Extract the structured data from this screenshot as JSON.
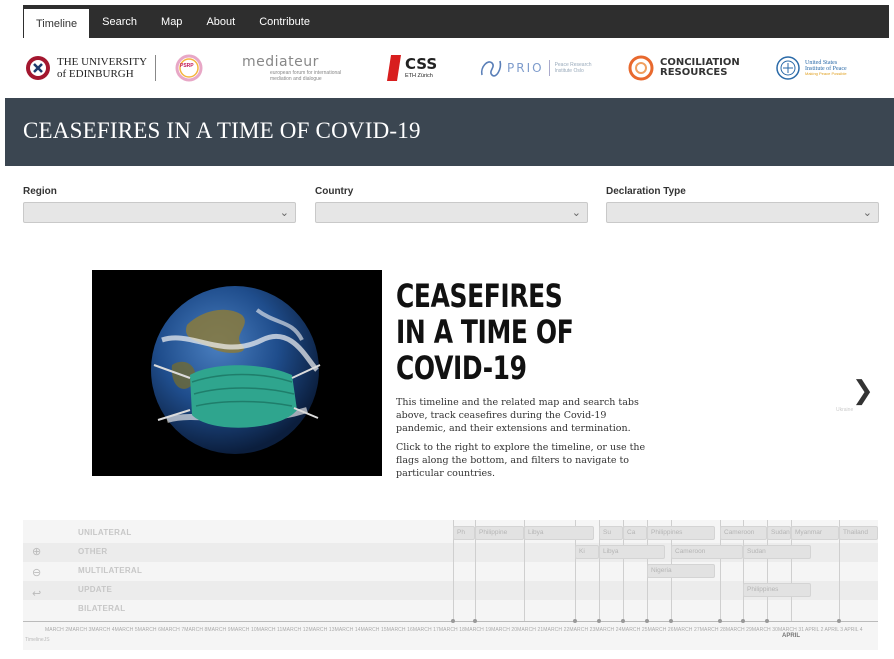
{
  "nav": {
    "tabs": [
      {
        "label": "Timeline",
        "active": true
      },
      {
        "label": "Search",
        "active": false
      },
      {
        "label": "Map",
        "active": false
      },
      {
        "label": "About",
        "active": false
      },
      {
        "label": "Contribute",
        "active": false
      }
    ]
  },
  "logos": {
    "edinburgh": {
      "line1": "THE UNIVERSITY",
      "line2": "of EDINBURGH"
    },
    "psrp": {
      "label": "PSRP"
    },
    "mediateur": {
      "name": "mediateur",
      "sub": "european forum for international mediation and dialogue"
    },
    "css": {
      "name": "CSS",
      "sub": "ETH Zürich"
    },
    "prio": {
      "name": "PRIO",
      "sub": "Peace Research Institute Oslo"
    },
    "conciliation": {
      "line1": "CONCILIATION",
      "line2": "RESOURCES"
    },
    "usip": {
      "line1": "United States",
      "line2": "Institute of Peace",
      "line3": "Making Peace Possible"
    }
  },
  "banner": {
    "title": "CEASEFIRES IN A TIME OF COVID-19"
  },
  "filters": {
    "region": {
      "label": "Region",
      "value": ""
    },
    "country": {
      "label": "Country",
      "value": ""
    },
    "declaration_type": {
      "label": "Declaration Type",
      "value": ""
    }
  },
  "slide": {
    "title": "CEASEFIRES IN A TIME OF COVID-19",
    "paragraph1": "This timeline and the related map and search tabs above, track ceasefires during the Covid-19 pandemic, and their extensions and termination.",
    "paragraph2": "Click to the right to explore the timeline, or use the flags along the bottom, and filters to navigate to particular countries.",
    "next_label": "Ukraine"
  },
  "timeline": {
    "rows": [
      "UNILATERAL",
      "OTHER",
      "MULTILATERAL",
      "UPDATE",
      "BILATERAL"
    ],
    "events": {
      "r0a": "Ph",
      "r0b": "Philippine",
      "r0c": "Libya",
      "r0d": "Su",
      "r0e": "Ca",
      "r0f": "Philippines",
      "r0g": "Cameroon",
      "r0h": "Sudan",
      "r0i": "Myanmar",
      "r0j": "Thailand",
      "r1a": "Ki",
      "r1b": "Libya",
      "r1c": "Cameroon",
      "r1d": "Sudan",
      "r2a": "Nigeria",
      "r3a": "Philippines"
    },
    "tick_labels": "MARCH 2MARCH 3MARCH 4MARCH 5MARCH 6MARCH 7MARCH 8MARCH 9MARCH 10MARCH 11MARCH 12MARCH 13MARCH 14MARCH 15MARCH 16MARCH 17MARCH 18MARCH 19MARCH 20MARCH 21MARCH 22MARCH 23MARCH 24MARCH 25MARCH 26MARCH 27MARCH 28MARCH 29MARCH 30MARCH 31",
    "april_label": "APRIL",
    "april_ticks": "APRIL 2   APRIL 3   APRIL 4",
    "credit": "TimelineJS"
  },
  "colors": {
    "nav_bg": "#2e2e2e",
    "banner_bg": "#3b4651",
    "css_red": "#d81e1e",
    "conciliation_orange": "#e8692e",
    "prio_blue": "#5a7fb8",
    "usip_blue": "#2a6aa8"
  }
}
